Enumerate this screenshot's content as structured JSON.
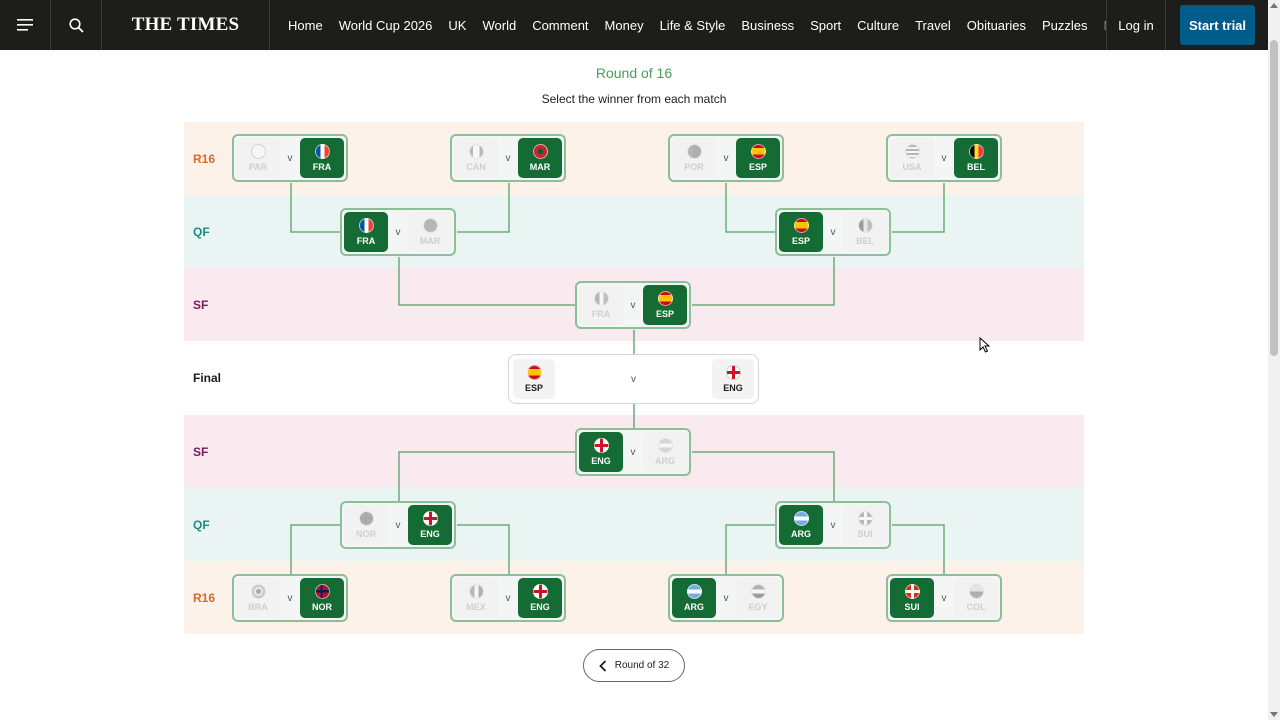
{
  "nav": {
    "menu_icon": "hamburger-menu-icon",
    "search_icon": "search-icon",
    "logo": "THE TIMES",
    "links": [
      "Home",
      "World Cup 2026",
      "UK",
      "World",
      "Comment",
      "Money",
      "Life & Style",
      "Business",
      "Sport",
      "Culture",
      "Travel",
      "Obituaries",
      "Puzzles",
      "Ma"
    ],
    "login": "Log in",
    "trial": "Start trial"
  },
  "page": {
    "title": "Round of 16",
    "subtitle": "Select the winner from each match",
    "back_label": "Round of 32"
  },
  "bands": {
    "r16": "R16",
    "qf": "QF",
    "sf": "SF",
    "final": "Final"
  },
  "colors": {
    "accent_green": "#146b33",
    "title_green": "#4a9b5c",
    "r16": "#d9692a",
    "qf": "#1f8a83",
    "sf": "#7a1a5a"
  },
  "bracket": {
    "top_r16": [
      {
        "home": "PAR",
        "away": "FRA",
        "winner": "away"
      },
      {
        "home": "CAN",
        "away": "MAR",
        "winner": "away"
      },
      {
        "home": "POR",
        "away": "ESP",
        "winner": "away"
      },
      {
        "home": "USA",
        "away": "BEL",
        "winner": "away"
      }
    ],
    "top_qf": [
      {
        "home": "FRA",
        "away": "MAR",
        "winner": "home"
      },
      {
        "home": "ESP",
        "away": "BEL",
        "winner": "home"
      }
    ],
    "top_sf": {
      "home": "FRA",
      "away": "ESP",
      "winner": "away"
    },
    "final": {
      "home": "ESP",
      "away": "ENG",
      "vs": "v"
    },
    "bottom_sf": {
      "home": "ENG",
      "away": "ARG",
      "winner": "home"
    },
    "bottom_qf": [
      {
        "home": "NOR",
        "away": "ENG",
        "winner": "away"
      },
      {
        "home": "ARG",
        "away": "SUI",
        "winner": "home"
      }
    ],
    "bottom_r16": [
      {
        "home": "BRA",
        "away": "NOR",
        "winner": "away"
      },
      {
        "home": "MEX",
        "away": "ENG",
        "winner": "away"
      },
      {
        "home": "ARG",
        "away": "EGY",
        "winner": "home"
      },
      {
        "home": "SUI",
        "away": "COL",
        "winner": "home"
      }
    ],
    "vs": "v"
  }
}
